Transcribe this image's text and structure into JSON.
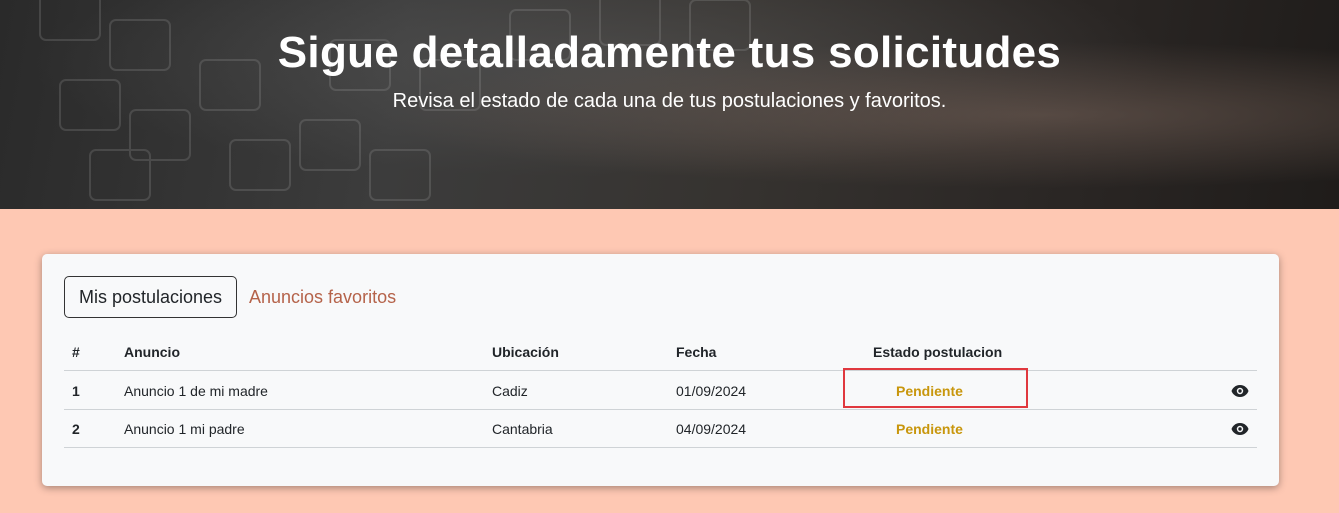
{
  "hero": {
    "title": "Sigue detalladamente tus solicitudes",
    "subtitle": "Revisa el estado de cada una de tus postulaciones y favoritos."
  },
  "tabs": {
    "active_label": "Mis postulaciones",
    "favorites_label": "Anuncios favoritos"
  },
  "table": {
    "headers": [
      "#",
      "Anuncio",
      "Ubicación",
      "Fecha",
      "Estado postulacion"
    ],
    "rows": [
      {
        "num": "1",
        "anuncio": "Anuncio 1 de mi madre",
        "ubicacion": "Cadiz",
        "fecha": "01/09/2024",
        "estado": "Pendiente",
        "action_icon": "eye-icon"
      },
      {
        "num": "2",
        "anuncio": "Anuncio 1 mi padre",
        "ubicacion": "Cantabria",
        "fecha": "04/09/2024",
        "estado": "Pendiente",
        "action_icon": "eye-icon"
      }
    ]
  },
  "colors": {
    "page_background": "#fec8b3",
    "tab_link": "#b5634a",
    "status_pending": "#c8960c",
    "highlight_box": "#e0383e"
  }
}
